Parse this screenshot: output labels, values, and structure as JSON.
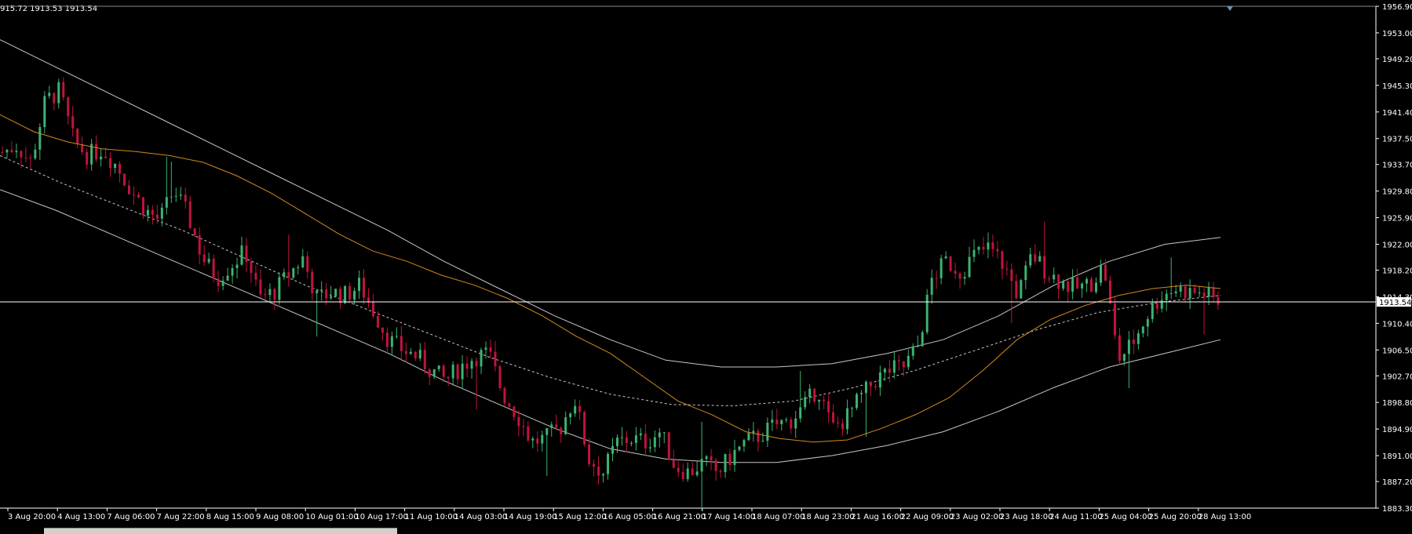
{
  "window": {
    "ohlc_readout": "915.72 1913.53 1913.54"
  },
  "colors": {
    "background": "#000000",
    "bull_candle": "#3cb371",
    "bear_candle": "#c0143c",
    "ma_line": "#d2891e",
    "channel_line": "#c8c8c8",
    "price_line": "#ffffff"
  },
  "chart_data": {
    "type": "candlestick",
    "current_price": "1913.54",
    "y_ticks": [
      "1956.90",
      "1953.00",
      "1949.20",
      "1945.30",
      "1941.40",
      "1937.50",
      "1933.70",
      "1929.80",
      "1925.90",
      "1922.00",
      "1918.20",
      "1914.30",
      "1910.40",
      "1906.50",
      "1902.70",
      "1898.80",
      "1894.90",
      "1891.00",
      "1887.20",
      "1883.30"
    ],
    "ylim": [
      1883.3,
      1956.9
    ],
    "x_ticks": [
      "3 Aug 20:00",
      "4 Aug 13:00",
      "7 Aug 06:00",
      "7 Aug 22:00",
      "8 Aug 15:00",
      "9 Aug 08:00",
      "10 Aug 01:00",
      "10 Aug 17:00",
      "11 Aug 10:00",
      "14 Aug 03:00",
      "14 Aug 19:00",
      "15 Aug 12:00",
      "16 Aug 05:00",
      "16 Aug 21:00",
      "17 Aug 14:00",
      "18 Aug 07:00",
      "18 Aug 23:00",
      "21 Aug 16:00",
      "22 Aug 09:00",
      "23 Aug 02:00",
      "23 Aug 18:00",
      "24 Aug 11:00",
      "25 Aug 04:00",
      "25 Aug 20:00",
      "28 Aug 13:00"
    ],
    "close_path": [
      1935.5,
      1936.5,
      1934.0,
      1943.0,
      1944.5,
      1937.0,
      1935.0,
      1936.0,
      1933.5,
      1930.0,
      1927.0,
      1925.5,
      1930.0,
      1926.0,
      1920.0,
      1917.0,
      1919.0,
      1921.0,
      1914.0,
      1915.0,
      1917.5,
      1920.0,
      1914.0,
      1915.0,
      1914.5,
      1916.0,
      1912.0,
      1908.0,
      1906.5,
      1905.5,
      1903.5,
      1902.0,
      1904.0,
      1905.5,
      1906.0,
      1900.0,
      1897.0,
      1893.0,
      1893.5,
      1895.0,
      1899.5,
      1890.5,
      1888.5,
      1893.0,
      1893.5,
      1893.0,
      1894.5,
      1889.5,
      1888.5,
      1890.0,
      1888.5,
      1891.0,
      1893.0,
      1894.0,
      1895.5,
      1896.0,
      1898.0,
      1901.0,
      1895.0,
      1896.5,
      1899.5,
      1902.0,
      1903.5,
      1904.0,
      1907.0,
      1917.0,
      1919.5,
      1918.0,
      1920.5,
      1921.5,
      1919.0,
      1914.5,
      1920.5,
      1918.0,
      1916.5,
      1915.5,
      1916.0,
      1919.0,
      1905.0,
      1907.5,
      1911.5,
      1914.5,
      1915.5,
      1915.0,
      1914.8,
      1913.54
    ],
    "ma_path": [
      1941.0,
      1938.5,
      1937.0,
      1936.0,
      1935.6,
      1935.0,
      1934.0,
      1932.0,
      1929.5,
      1926.5,
      1923.5,
      1921.0,
      1919.5,
      1917.5,
      1916.0,
      1914.0,
      1911.5,
      1908.5,
      1906.0,
      1902.5,
      1899.0,
      1897.0,
      1894.5,
      1893.5,
      1893.0,
      1893.3,
      1895.0,
      1897.0,
      1899.5,
      1903.5,
      1908.0,
      1911.0,
      1913.0,
      1914.5,
      1915.5,
      1916.0,
      1915.5
    ],
    "channel_mid_path": [
      1935.0,
      1931.0,
      1927.5,
      1924.0,
      1920.0,
      1916.0,
      1912.5,
      1909.0,
      1905.5,
      1902.5,
      1900.0,
      1898.5,
      1898.3,
      1899.0,
      1901.0,
      1903.5,
      1906.5,
      1909.5,
      1912.0,
      1913.5,
      1914.5
    ],
    "channel_upper_path": [
      1952.0,
      1948.0,
      1944.0,
      1940.0,
      1936.0,
      1932.0,
      1928.0,
      1924.0,
      1919.5,
      1915.5,
      1911.5,
      1908.0,
      1905.0,
      1904.0,
      1904.0,
      1904.5,
      1906.0,
      1908.0,
      1911.5,
      1916.0,
      1919.5,
      1922.0,
      1923.0
    ],
    "channel_lower_path": [
      1930.0,
      1927.0,
      1923.5,
      1920.0,
      1916.5,
      1913.0,
      1909.5,
      1906.0,
      1902.0,
      1898.5,
      1895.0,
      1892.0,
      1890.5,
      1890.0,
      1890.0,
      1891.0,
      1892.5,
      1894.5,
      1897.5,
      1901.0,
      1904.0,
      1906.0,
      1908.0
    ]
  }
}
